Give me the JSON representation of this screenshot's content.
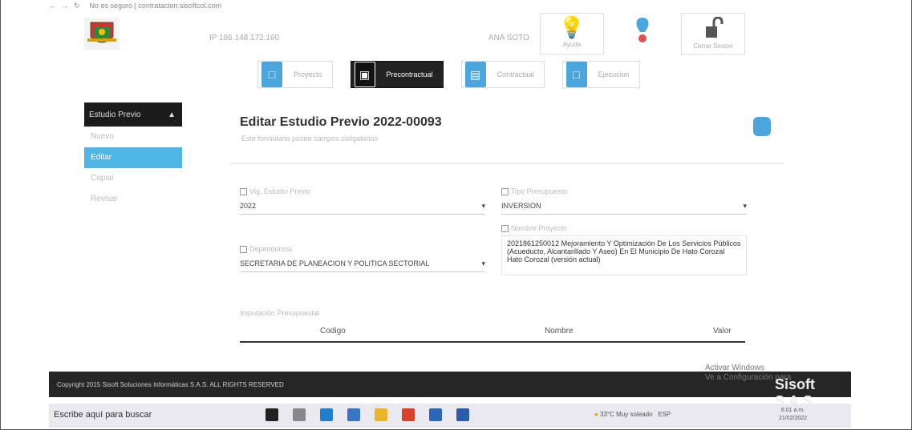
{
  "browser": {
    "url_text": "No es seguro | contratacion.sisoftcol.com"
  },
  "header": {
    "ip": "IP 186.148.172.160",
    "user": "ANA SOTO",
    "help_label": "Ayuda",
    "logout_label": "Cerrar Sesion"
  },
  "steps": [
    {
      "label": "Proyecto",
      "color": "#4aa6dc"
    },
    {
      "label": "Precontractual",
      "color": "#111111"
    },
    {
      "label": "Contractual",
      "color": "#4aa6dc"
    },
    {
      "label": "Ejecucion",
      "color": "#4aa6dc"
    }
  ],
  "sidebar": {
    "header": "Estudio Previo",
    "items": [
      {
        "label": "Nuevo"
      },
      {
        "label": "Editar"
      },
      {
        "label": "Copiar"
      },
      {
        "label": "Revisar"
      }
    ]
  },
  "form": {
    "title": "Editar Estudio Previo 2022-00093",
    "subtitle": "Este formulario posee campos obligatorios",
    "vig_label": "Vig. Estudio Previo",
    "vig_value": "2022",
    "tipo_label": "Tipo Presupuesto",
    "tipo_value": "INVERSION",
    "dep_label": "Dependencia",
    "dep_value": "SECRETARIA DE PLANEACION Y POLITICA SECTORIAL",
    "nombre_label": "Nombre Proyecto",
    "nombre_value": "2021861250012 Mejoramiento Y Optimización De Los Servicios Públicos (Acueducto, Alcantarillado Y Aseo) En El Municipio De Hato Corozal Hato Corozal (versión actual)",
    "imputacion_label": "Imputación Presupuestal",
    "col_codigo": "Codigo",
    "col_nombre": "Nombre",
    "col_valor": "Valor"
  },
  "footer": {
    "copyright": "Copyright 2015 Sisoft Soluciones Informáticas S.A.S. ALL RIGHTS RESERVED",
    "watermark_line1": "Activar Windows",
    "watermark_line2": "Ve a Configuración para",
    "brand": "Sisoft S.A.S"
  },
  "taskbar": {
    "search_placeholder": "Escribe aquí para buscar",
    "weather": "33°C Muy soleado",
    "lang": "ESP",
    "time": "6:01 a.m.",
    "date": "21/02/2022"
  }
}
